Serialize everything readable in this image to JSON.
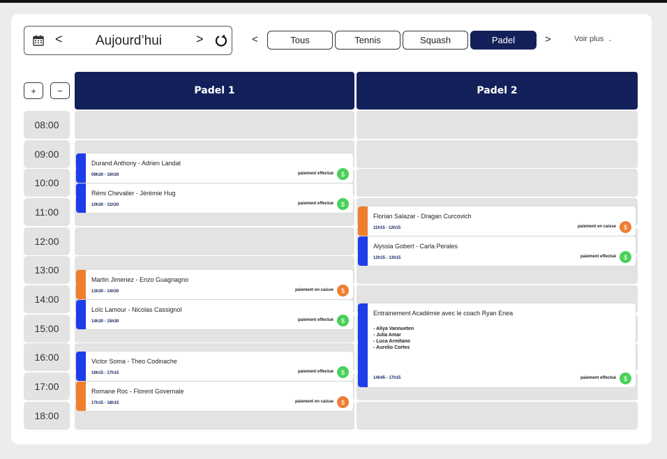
{
  "date_nav": {
    "label": "Aujourd’hui",
    "prev": "<",
    "next": ">"
  },
  "sports": {
    "prev": "<",
    "next": ">",
    "items": [
      "Tous",
      "Tennis",
      "Squash",
      "Padel"
    ],
    "active": "Padel",
    "more": "Voir plus",
    "more_chevron": "⌄"
  },
  "zoom": {
    "plus": "+",
    "minus": "−"
  },
  "courts": [
    "Padel 1",
    "Padel 2"
  ],
  "times": [
    "08:00",
    "09:00",
    "10:00",
    "11:00",
    "12:00",
    "13:00",
    "14:00",
    "15:00",
    "16:00",
    "17:00",
    "18:00"
  ],
  "colors": {
    "navy": "#13205a",
    "blue": "#1d3de8",
    "orange": "#ef7f2d",
    "green": "#49d15a",
    "orange_dollar": "#ee7d33",
    "slot": "#e3e3e3"
  },
  "events": {
    "padel1": [
      {
        "title": "Durand Anthony - Adrien Landat",
        "hours": "09h30 - 10h30",
        "payment": "paiement effectué",
        "dollar": "$"
      },
      {
        "title": "Rémi Chevalier - Jérémie Hug",
        "hours": "10h30 - 11h30",
        "payment": "paiement effectué",
        "dollar": "$"
      },
      {
        "title": "Martin Jimenez - Enzo Guagnagno",
        "hours": "13h30 - 14h30",
        "payment": "paiement en caisse",
        "dollar": "$"
      },
      {
        "title": "Loïc Lamour - Nicolas Cassignol",
        "hours": "14h30 - 15h30",
        "payment": "paiement effectué",
        "dollar": "$"
      },
      {
        "title": "Victor Soma - Theo Codinache",
        "hours": "16h15 - 17h15",
        "payment": "paiement effectué",
        "dollar": "$"
      },
      {
        "title": "Romane Roc - Florent Governale",
        "hours": "17h15 - 18h15",
        "payment": "paiement en caisse",
        "dollar": "$"
      }
    ],
    "padel2": [
      {
        "title": "Florian Salazar - Dragan Curcovich",
        "hours": "11h15 - 12h15",
        "payment": "paiement en caisse",
        "dollar": "$"
      },
      {
        "title": "Alyssia Gobert - Carla Perales",
        "hours": "12h15 - 13h15",
        "payment": "paiement effectué",
        "dollar": "$"
      },
      {
        "title": "Entrainement Académie avec le coach Ryan Enea",
        "players": [
          "- Aliya Vannueten",
          "- Julia Amar",
          "- Luca Armitano",
          "- Aurelio Cortes"
        ],
        "hours": "14h45 - 17h15",
        "payment": "paiement effectué",
        "dollar": "$"
      }
    ]
  }
}
